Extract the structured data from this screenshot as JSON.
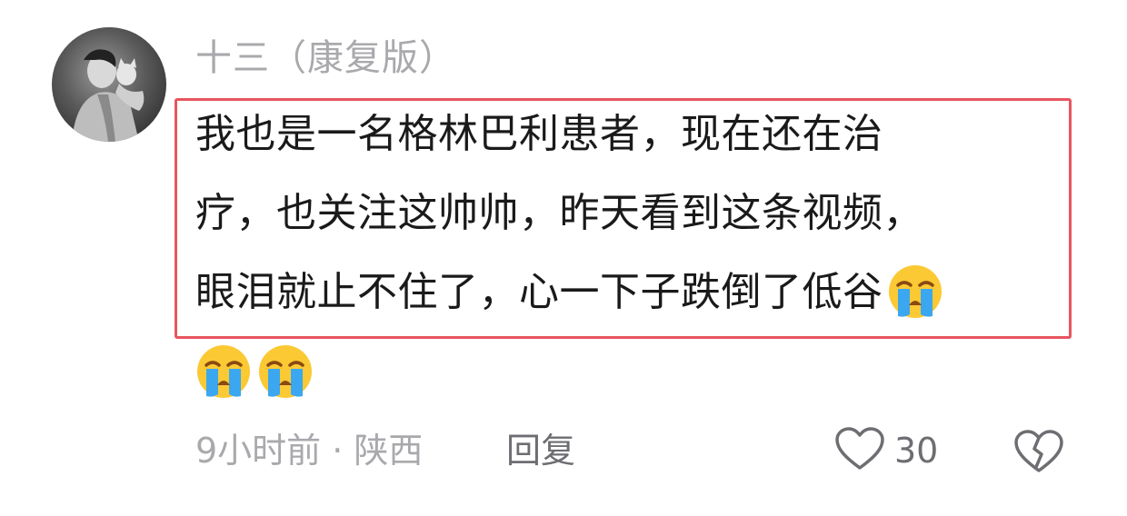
{
  "comment": {
    "username": "十三（康复版）",
    "text_lines": [
      "我也是一名格林巴利患者，现在还在治",
      "疗，也关注这帅帅，昨天看到这条视频，",
      "眼泪就止不住了，心一下子跌倒了低谷"
    ],
    "emojis": [
      "loudly-crying-face",
      "loudly-crying-face",
      "loudly-crying-face"
    ],
    "meta": "9小时前 · 陕西",
    "reply_label": "回复",
    "like_count": "30"
  },
  "colors": {
    "highlight_border": "#e8555f",
    "muted_text": "#a9a9ad",
    "body_text": "#1a1a1a",
    "action_text": "#6d6d72"
  }
}
